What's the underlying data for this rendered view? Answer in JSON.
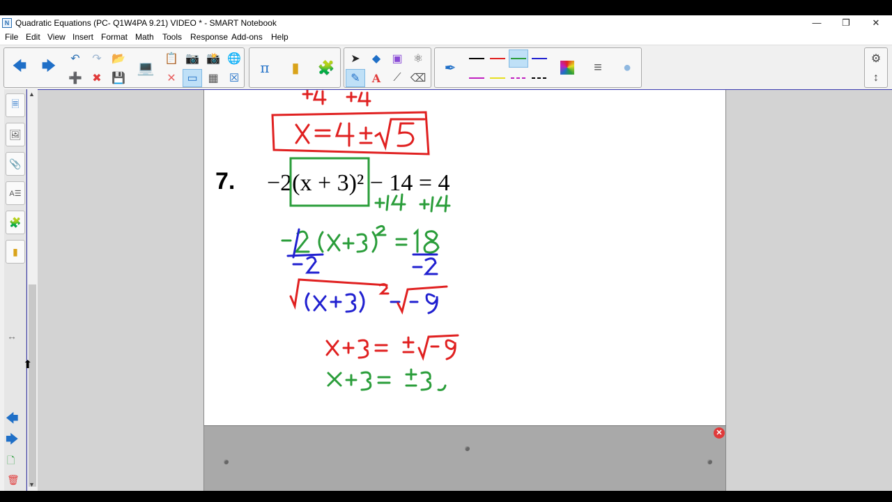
{
  "window": {
    "title": "Quadratic Equations (PC- Q1W4PA 9.21) VIDEO * - SMART Notebook",
    "minimize_icon": "minimize-icon",
    "restore_icon": "restore-icon",
    "close_icon": "close-icon"
  },
  "menu": [
    "File",
    "Edit",
    "View",
    "Insert",
    "Format",
    "Math",
    "Tools",
    "Response",
    "Add-ons",
    "Help"
  ],
  "toolbar": {
    "groups": [
      "navigation",
      "page-actions",
      "math-tools",
      "select-pen-tools",
      "pen-styles",
      "settings"
    ],
    "pen_colors": [
      "#000000",
      "#e02020",
      "#2a9d3a",
      "#2020d0",
      "#c020c0",
      "#e6e020"
    ]
  },
  "page": {
    "problem_number": "7.",
    "equation": "−2(x + 3)² − 14 = 4",
    "handwriting": {
      "line1": "+4   +4",
      "boxed_answer_prev": "x = 4 ± √5",
      "step_add14": "+14   +14",
      "step_divide": "−2(x+3)² = 18",
      "step_divide_den": "−2          −2",
      "step_sqrt": "√(x+3)² = √−9",
      "step_pm": "x + 3 = ± √−9",
      "step_final": "x + 3 = ± 3i"
    }
  },
  "colors": {
    "red": "#e02020",
    "green": "#2a9d3a",
    "blue": "#2020d0",
    "accent": "#3a3ab0"
  }
}
